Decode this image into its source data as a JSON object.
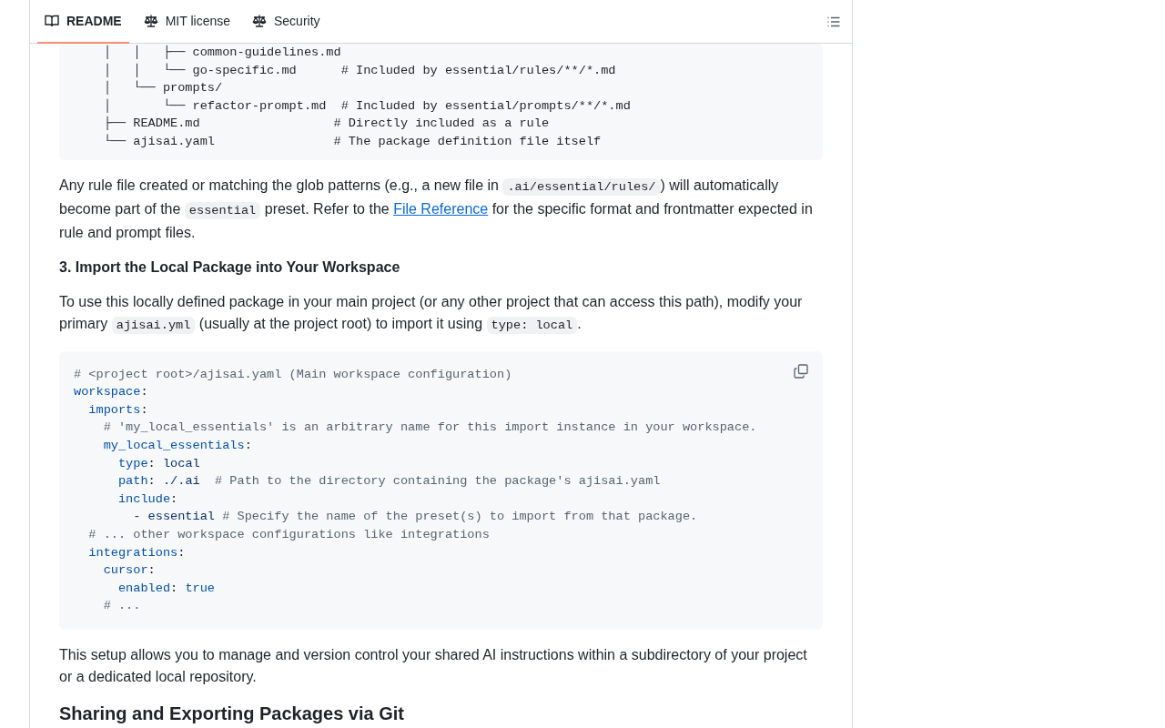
{
  "tabs": [
    {
      "label": "README",
      "selected": true
    },
    {
      "label": "MIT license",
      "selected": false
    },
    {
      "label": "Security",
      "selected": false
    }
  ],
  "content": [
    {
      "kind": "tree",
      "lines": [
        "│   │   ├── common-guidelines.md",
        "│   │   └── go-specific.md      # Included by essential/rules/**/*.md",
        "│   └── prompts/",
        "│       └── refactor-prompt.md  # Included by essential/prompts/**/*.md",
        "├── README.md                  # Directly included as a rule",
        "└── ajisai.yaml                # The package definition file itself"
      ]
    },
    {
      "kind": "paragraph",
      "parts": [
        {
          "kind": "text",
          "text": "Any rule file created or matching the glob patterns (e.g., a new file in "
        },
        {
          "kind": "code",
          "text": ".ai/essential/rules/"
        },
        {
          "kind": "text",
          "text": ") will automatically become part of the "
        },
        {
          "kind": "code",
          "text": "essential"
        },
        {
          "kind": "text",
          "text": " preset. Refer to the "
        },
        {
          "kind": "link",
          "text": "File Reference"
        },
        {
          "kind": "text",
          "text": " for the specific format and frontmatter expected in rule and prompt files."
        }
      ]
    },
    {
      "kind": "h3",
      "text": "3. Import the Local Package into Your Workspace"
    },
    {
      "kind": "paragraph",
      "parts": [
        {
          "kind": "text",
          "text": "To use this locally defined package in your main project (or any other project that can access this path), modify your primary "
        },
        {
          "kind": "code",
          "text": "ajisai.yml"
        },
        {
          "kind": "text",
          "text": " (usually at the project root) to import it using "
        },
        {
          "kind": "code",
          "text": "type: local"
        },
        {
          "kind": "text",
          "text": "."
        }
      ]
    },
    {
      "kind": "yaml",
      "lines": [
        [
          {
            "kind": "comment",
            "text": "# <project root>/ajisai.yaml (Main workspace configuration)"
          }
        ],
        [
          {
            "kind": "key",
            "text": "workspace"
          },
          {
            "kind": "plain",
            "text": ":"
          }
        ],
        [
          {
            "kind": "key",
            "text": "  imports"
          },
          {
            "kind": "plain",
            "text": ":"
          }
        ],
        [
          {
            "kind": "comment",
            "text": "    # 'my_local_essentials' is an arbitrary name for this import instance in your workspace."
          }
        ],
        [
          {
            "kind": "key",
            "text": "    my_local_essentials"
          },
          {
            "kind": "plain",
            "text": ":"
          }
        ],
        [
          {
            "kind": "key",
            "text": "      type"
          },
          {
            "kind": "plain",
            "text": ": "
          },
          {
            "kind": "value",
            "text": "local"
          }
        ],
        [
          {
            "kind": "key",
            "text": "      path"
          },
          {
            "kind": "plain",
            "text": ": "
          },
          {
            "kind": "value",
            "text": "./.ai"
          },
          {
            "kind": "comment",
            "text": "  # Path to the directory containing the package's ajisai.yaml"
          }
        ],
        [
          {
            "kind": "key",
            "text": "      include"
          },
          {
            "kind": "plain",
            "text": ":"
          }
        ],
        [
          {
            "kind": "plain",
            "text": "        - "
          },
          {
            "kind": "value",
            "text": "essential"
          },
          {
            "kind": "comment",
            "text": " # Specify the name of the preset(s) to import from that package."
          }
        ],
        [
          {
            "kind": "comment",
            "text": "  # ... other workspace configurations like integrations"
          }
        ],
        [
          {
            "kind": "key",
            "text": "  integrations"
          },
          {
            "kind": "plain",
            "text": ":"
          }
        ],
        [
          {
            "kind": "key",
            "text": "    cursor"
          },
          {
            "kind": "plain",
            "text": ":"
          }
        ],
        [
          {
            "kind": "key",
            "text": "      enabled"
          },
          {
            "kind": "plain",
            "text": ": "
          },
          {
            "kind": "bool",
            "text": "true"
          }
        ],
        [
          {
            "kind": "comment",
            "text": "    # ..."
          }
        ]
      ]
    },
    {
      "kind": "paragraph",
      "parts": [
        {
          "kind": "text",
          "text": "This setup allows you to manage and version control your shared AI instructions within a subdirectory of your project or a dedicated local repository."
        }
      ]
    },
    {
      "kind": "h2",
      "text": "Sharing and Exporting Packages via Git"
    }
  ]
}
